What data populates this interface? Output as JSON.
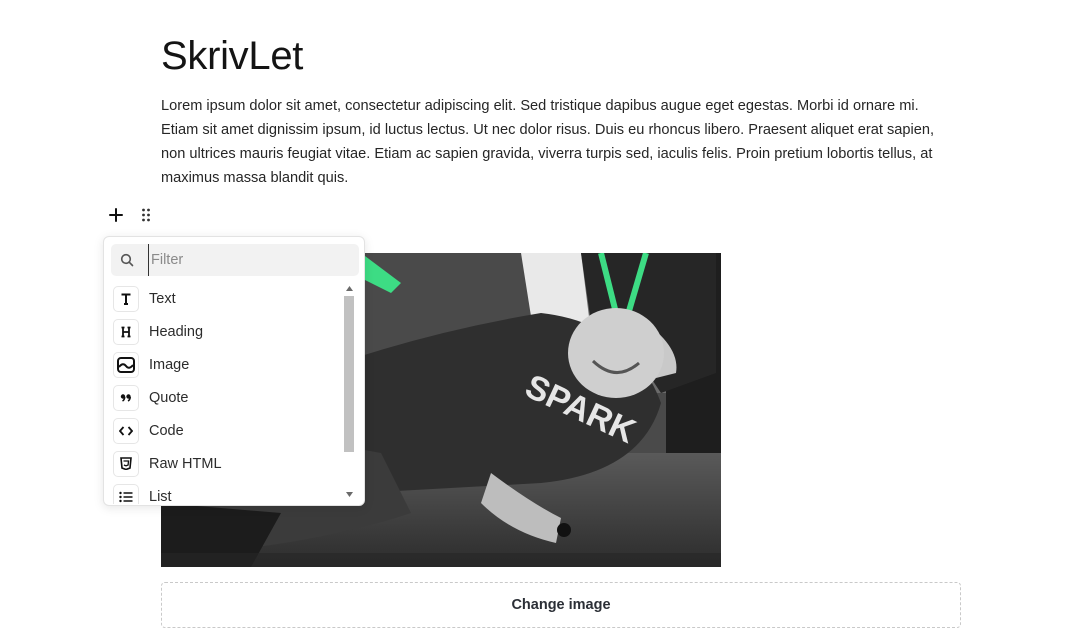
{
  "page": {
    "title": "SkrivLet",
    "paragraph": "Lorem ipsum dolor sit amet, consectetur adipiscing elit. Sed tristique dapibus augue eget egestas. Morbi id ornare mi. Etiam sit amet dignissim ipsum, id luctus lectus. Ut nec dolor risus. Duis eu rhoncus libero. Praesent aliquet erat sapien, non ultrices mauris feugiat vitae. Etiam ac sapien gravida, viverra turpis sed, iaculis felis. Proin pretium lobortis tellus, at maximus massa blandit quis."
  },
  "block_controls": {
    "add_icon": "plus-icon",
    "drag_icon": "drag-handle-icon"
  },
  "block_menu": {
    "filter": {
      "placeholder": "Filter",
      "value": "",
      "icon": "search-icon"
    },
    "items": [
      {
        "label": "Text",
        "icon": "T"
      },
      {
        "label": "Heading",
        "icon": "H"
      },
      {
        "label": "Image",
        "icon": "image-icon"
      },
      {
        "label": "Quote",
        "icon": "quote-icon"
      },
      {
        "label": "Code",
        "icon": "code-icon"
      },
      {
        "label": "Raw HTML",
        "icon": "html5-icon"
      },
      {
        "label": "List",
        "icon": "list-icon"
      }
    ]
  },
  "image_block": {
    "printed_text": "SPARK",
    "change_label": "Change image"
  },
  "colors": {
    "accent_green": "#3ddc84",
    "text": "#262626",
    "menu_border": "#e3e3e3",
    "filter_bg": "#f2f2f2"
  }
}
